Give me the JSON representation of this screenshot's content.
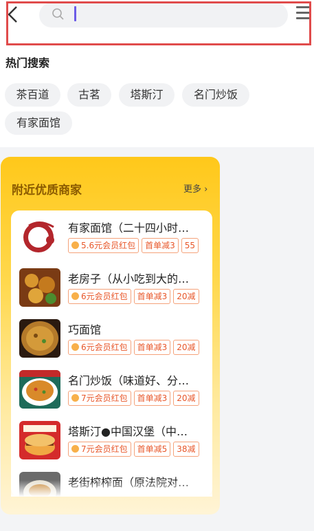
{
  "search": {
    "placeholder": ""
  },
  "hot": {
    "title": "热门搜索",
    "tags": [
      "茶百道",
      "古茗",
      "塔斯汀",
      "名门炒饭",
      "有家面馆"
    ]
  },
  "nearby": {
    "title": "附近优质商家",
    "more": "更多",
    "shops": [
      {
        "name": "有家面馆（二十四小时…",
        "badges": [
          "5.6元会员红包",
          "首单减3",
          "55"
        ]
      },
      {
        "name": "老房子（从小吃到大的…",
        "badges": [
          "6元会员红包",
          "首单减3",
          "20减"
        ]
      },
      {
        "name": "巧面馆",
        "badges": [
          "6元会员红包",
          "首单减3",
          "20减"
        ]
      },
      {
        "name": "名门炒饭（味道好、分…",
        "badges": [
          "7元会员红包",
          "首单减3",
          "20减"
        ]
      },
      {
        "name": "塔斯汀●中国汉堡（中…",
        "badges": [
          "7元会员红包",
          "首单减5",
          "38减"
        ]
      },
      {
        "name": "老街榨榨面（原法院对…",
        "badges": []
      }
    ]
  },
  "colors": {
    "accent": "#ffc81a",
    "badge": "#e8572a",
    "highlight_border": "#e04b4b"
  }
}
